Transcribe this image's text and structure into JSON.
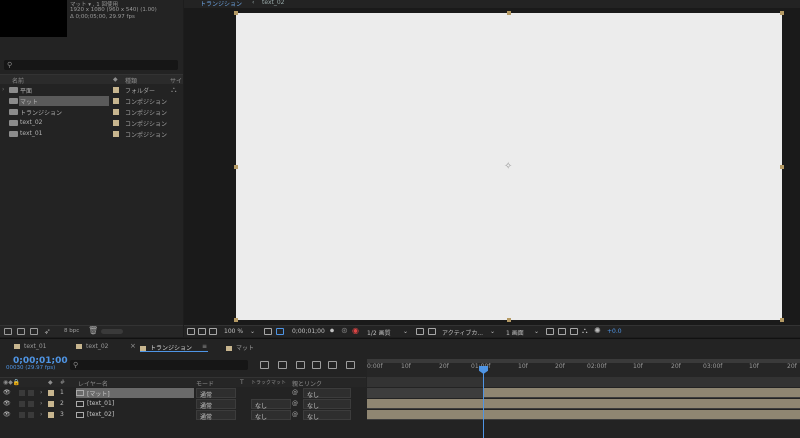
{
  "project": {
    "item_name": "マット ▾ , 1 回使用",
    "item_size": "1920 x 1080 (960 x 540) (1.00)",
    "item_duration": "Δ 0;00;05;00, 29.97 fps",
    "search_icon": "search-icon",
    "columns": {
      "name": "名前",
      "type": "種類",
      "size": "サイ"
    },
    "items": [
      {
        "name": "平面",
        "type": "フォルダー",
        "is_folder": true
      },
      {
        "name": "マット",
        "type": "コンポジション",
        "selected": true
      },
      {
        "name": "トランジション",
        "type": "コンポジション"
      },
      {
        "name": "text_02",
        "type": "コンポジション"
      },
      {
        "name": "text_01",
        "type": "コンポジション"
      }
    ],
    "bpc": "8 bpc"
  },
  "viewer": {
    "tabs": [
      {
        "label": "トランジション",
        "active": true
      },
      {
        "label": "text_02"
      }
    ],
    "zoom": "100 %",
    "timecode": "0;00;01;00",
    "resolution": "1/2 画質",
    "camera": "アクティブカ...",
    "views": "1 画面",
    "exposure": "+0.0",
    "canvas_color": "#ececec"
  },
  "timeline": {
    "tabs": [
      {
        "label": "text_01"
      },
      {
        "label": "text_02"
      },
      {
        "label": "トランジション",
        "active": true
      },
      {
        "label": "マット"
      }
    ],
    "timecode": "0;00;01;00",
    "fps": "00030 (29.97 fps)",
    "columns": {
      "hash": "#",
      "layer_name": "レイヤー名",
      "mode": "モード",
      "t": "T",
      "track_matte": "トラックマット",
      "parent": "親とリンク"
    },
    "layers": [
      {
        "num": "1",
        "name": "[マット]",
        "mode": "通常",
        "track_matte": "",
        "parent": "なし",
        "selected": true
      },
      {
        "num": "2",
        "name": "[text_01]",
        "mode": "通常",
        "track_matte": "なし",
        "parent": "なし"
      },
      {
        "num": "3",
        "name": "[text_02]",
        "mode": "通常",
        "track_matte": "なし",
        "parent": "なし"
      }
    ],
    "ruler_ticks": [
      "0:00f",
      "10f",
      "20f",
      "01:00f",
      "10f",
      "20f",
      "02:00f",
      "10f",
      "20f",
      "03:00f",
      "10f",
      "20f"
    ],
    "accent_color": "#4f95e5",
    "label_color": "#c7b58e"
  }
}
